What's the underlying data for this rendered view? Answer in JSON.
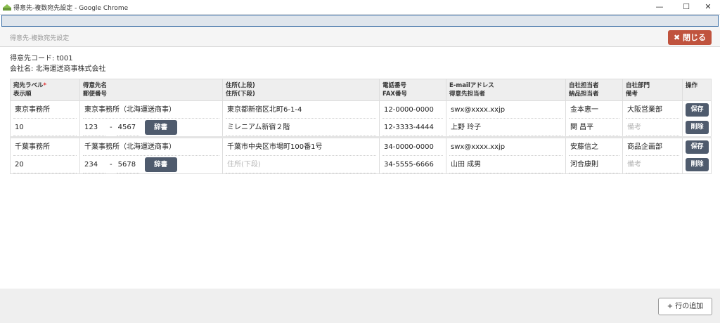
{
  "window": {
    "title": "得意先-複数宛先設定 - Google Chrome",
    "minimize": "—",
    "maximize": "☐",
    "close": "✕"
  },
  "header": {
    "page_title": "得意先-複数宛先設定",
    "close_label": "✖ 閉じる"
  },
  "info": {
    "customer_code_label": "得意先コード:",
    "customer_code": "t001",
    "company_label": "会社名:",
    "company_name": "北海運送商事株式会社"
  },
  "table": {
    "headers": [
      {
        "line1": "宛先ラベル",
        "required": "*",
        "line2": "表示順"
      },
      {
        "line1": "得意先名",
        "line2": "郵便番号"
      },
      {
        "line1": "住所(上段)",
        "line2": "住所(下段)"
      },
      {
        "line1": "電話番号",
        "line2": "FAX番号"
      },
      {
        "line1": "E-mailアドレス",
        "line2": "得意先担当者"
      },
      {
        "line1": "自社担当者",
        "line2": "納品担当者"
      },
      {
        "line1": "自社部門",
        "line2": "備考"
      },
      {
        "line1": "操作",
        "line2": ""
      }
    ],
    "rows": [
      {
        "label": "東京事務所",
        "order": "10",
        "name": "東京事務所（北海運送商事）",
        "zip1": "123",
        "zip_sep": "-",
        "zip2": "4567",
        "dict": "辞書",
        "addr1": "東京都新宿区北町6-1-4",
        "addr2": "ミレニアム新宿２階",
        "tel": "12-0000-0000",
        "fax": "12-3333-4444",
        "email": "swx@xxxx.xxjp",
        "contact": "上野 玲子",
        "staff": "金本恵一",
        "delivery": "関 昌平",
        "dept": "大阪営業部",
        "note": "",
        "note_placeholder": "備考",
        "addr2_placeholder": "住所(下段)",
        "save": "保存",
        "delete": "削除"
      },
      {
        "label": "千葉事務所",
        "order": "20",
        "name": "千葉事務所（北海運送商事）",
        "zip1": "234",
        "zip_sep": "-",
        "zip2": "5678",
        "dict": "辞書",
        "addr1": "千葉市中央区市場町100番1号",
        "addr2": "",
        "addr2_placeholder": "住所(下段)",
        "tel": "34-0000-0000",
        "fax": "34-5555-6666",
        "email": "swx@xxxx.xxjp",
        "contact": "山田 成男",
        "staff": "安藤信之",
        "delivery": "河合康則",
        "dept": "商品企画部",
        "note": "",
        "note_placeholder": "備考",
        "save": "保存",
        "delete": "削除"
      }
    ]
  },
  "footer": {
    "add_row_label": "+ 行の追加"
  },
  "colors": {
    "close_button": "#c0533e",
    "action_button": "#4f5b6d",
    "header_bg": "#eeeeee"
  }
}
